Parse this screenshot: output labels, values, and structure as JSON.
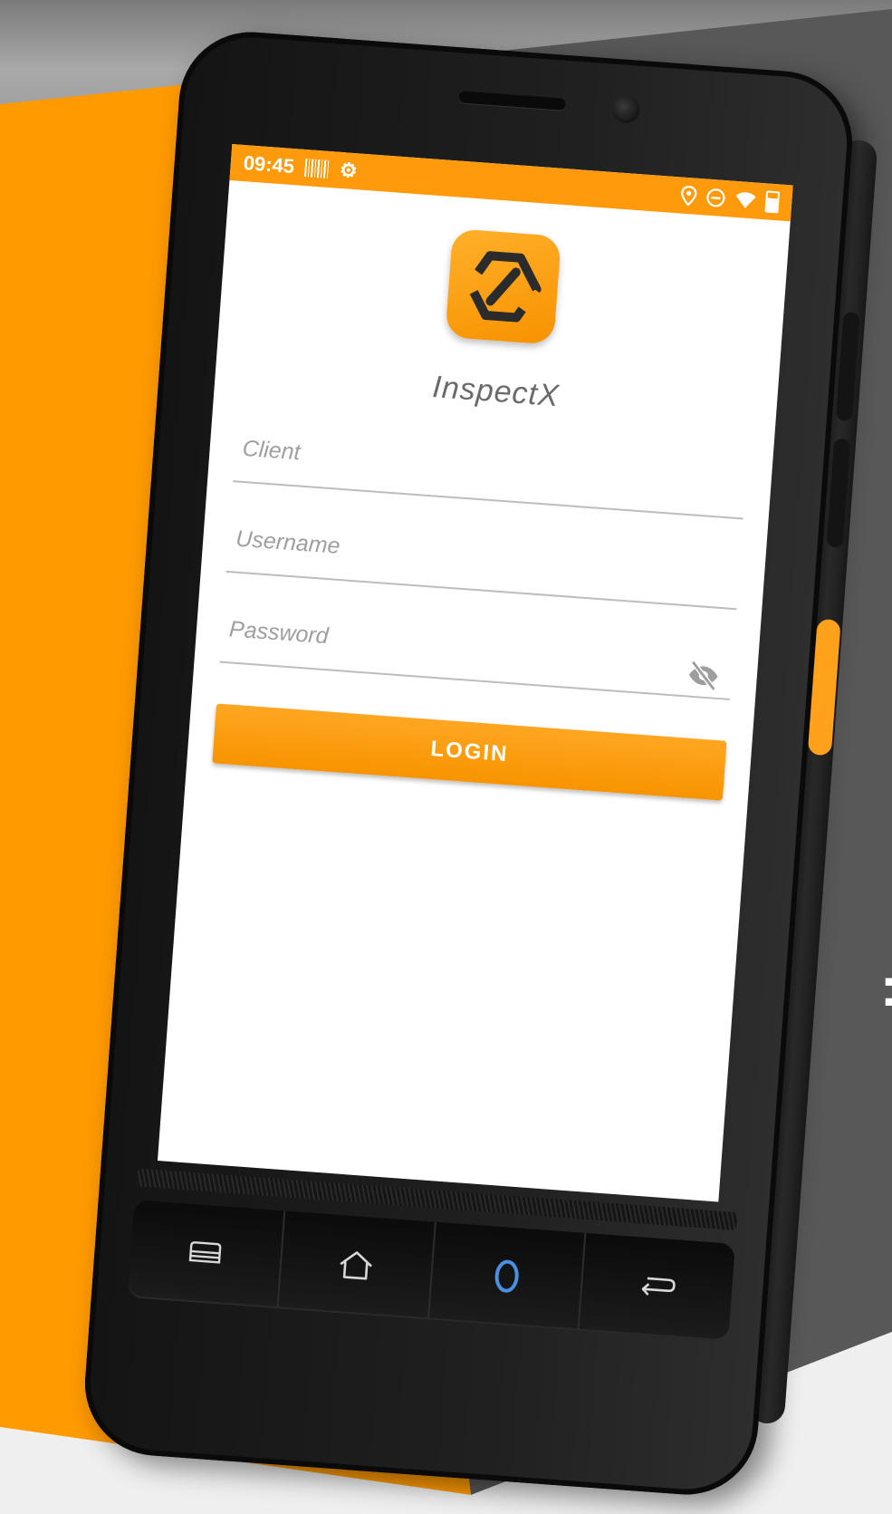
{
  "status_bar": {
    "time": "09:45",
    "left_icons": [
      "barcode-icon",
      "gear-icon"
    ],
    "right_icons": [
      "location-pin-icon",
      "do-not-disturb-icon",
      "wifi-icon",
      "battery-icon"
    ]
  },
  "app": {
    "name": "InspectX",
    "brand_color": "#ff9a00"
  },
  "login_form": {
    "client_placeholder": "Client",
    "client_value": "",
    "username_placeholder": "Username",
    "username_value": "",
    "password_placeholder": "Password",
    "password_value": "",
    "password_visibility_icon": "eye-off-icon",
    "login_label": "LOGIN"
  },
  "hardware_keys": [
    "menu-icon",
    "home-icon",
    "circle-icon",
    "back-icon"
  ]
}
